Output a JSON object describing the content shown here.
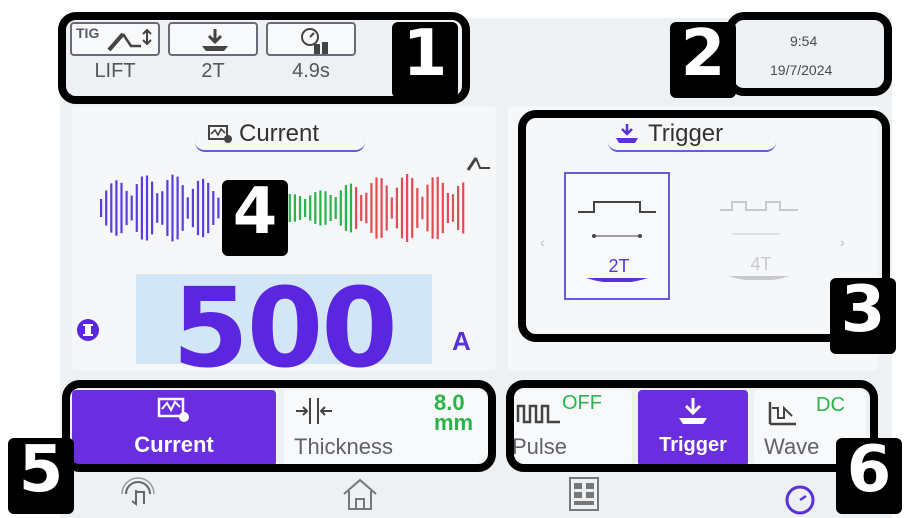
{
  "status_bar": {
    "mode_badge": "TIG",
    "mode_value": "LIFT",
    "trigger_value": "2T",
    "time_value": "4.9s",
    "clock_time": "9:54",
    "clock_date": "19/7/2024",
    "icons": [
      "tig-torch-icon",
      "trigger-icon",
      "timer-gas-icon"
    ]
  },
  "current_panel": {
    "title": "Current",
    "value": "500",
    "unit": "A",
    "icons": [
      "current-meter-icon",
      "torch-small-icon",
      "info-i-icon"
    ]
  },
  "trigger_panel": {
    "title": "Trigger",
    "options": [
      {
        "label": "2T",
        "selected": true
      },
      {
        "label": "4T",
        "selected": false
      }
    ],
    "icons": [
      "trigger-icon",
      "chevron-left-icon",
      "chevron-right-icon"
    ]
  },
  "bottom_left_tabs": [
    {
      "label": "Current",
      "active": true,
      "icon": "current-meter-icon"
    },
    {
      "label": "Thickness",
      "active": false,
      "icon": "thickness-icon",
      "value": "8.0",
      "unit": "mm"
    }
  ],
  "bottom_right_tabs": [
    {
      "label": "Pulse",
      "active": false,
      "icon": "pulse-wave-icon",
      "value": "OFF"
    },
    {
      "label": "Trigger",
      "active": true,
      "icon": "trigger-icon"
    },
    {
      "label": "Wave",
      "active": false,
      "icon": "wave-shape-icon",
      "value": "DC"
    }
  ],
  "nav": {
    "icons": [
      "touch-icon",
      "home-icon",
      "menu-grid-icon",
      "dial-icon"
    ]
  },
  "annotations": {
    "labels": [
      "1",
      "2",
      "3",
      "4",
      "5",
      "6"
    ]
  },
  "colors": {
    "accent": "#6a2de0",
    "green": "#2bb34a",
    "red": "#e34c52",
    "screen_bg": "#eef1f4"
  }
}
